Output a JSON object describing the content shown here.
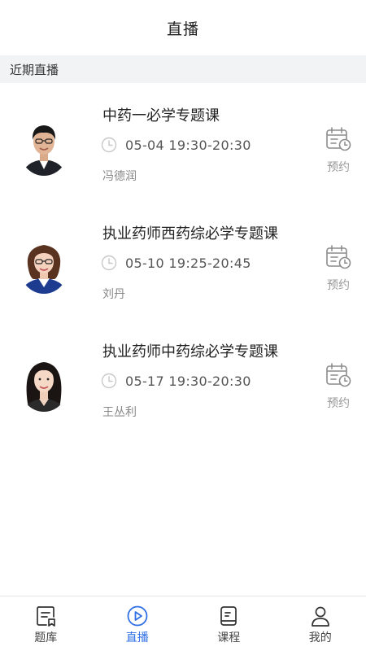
{
  "header": {
    "title": "直播"
  },
  "section": {
    "title": "近期直播"
  },
  "lives": [
    {
      "title": "中药一必学专题课",
      "time": "05-04 19:30-20:30",
      "teacher": "冯德润",
      "action": "预约"
    },
    {
      "title": "执业药师西药综必学专题课",
      "time": "05-10 19:25-20:45",
      "teacher": "刘丹",
      "action": "预约"
    },
    {
      "title": "执业药师中药综必学专题课",
      "time": "05-17 19:30-20:30",
      "teacher": "王丛利",
      "action": "预约"
    }
  ],
  "tabbar": {
    "items": [
      {
        "label": "题库",
        "icon": "question-bank-icon"
      },
      {
        "label": "直播",
        "icon": "play-circle-icon",
        "active": true
      },
      {
        "label": "课程",
        "icon": "course-icon"
      },
      {
        "label": "我的",
        "icon": "user-icon"
      }
    ]
  },
  "colors": {
    "accent": "#2f6fe4",
    "section_bg": "#f2f3f5",
    "muted": "#999999"
  }
}
